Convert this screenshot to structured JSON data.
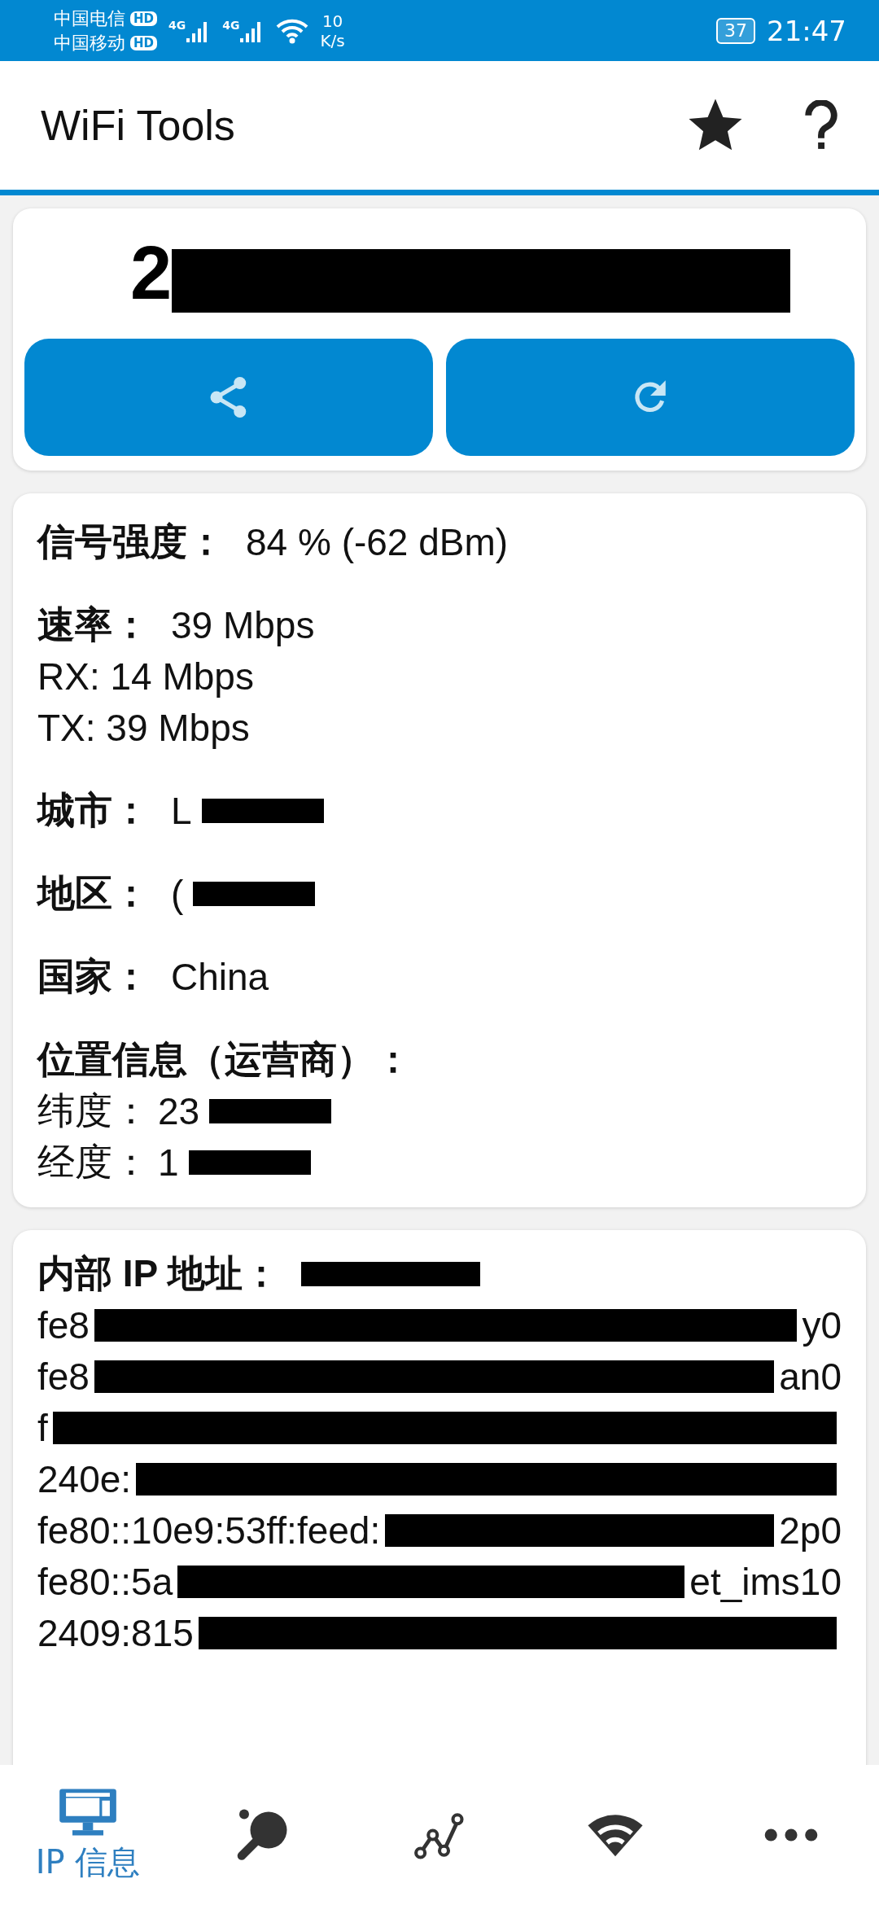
{
  "status_bar": {
    "carriers": [
      {
        "name": "中国电信",
        "badge": "HD",
        "network": "4G"
      },
      {
        "name": "中国移动",
        "badge": "HD",
        "network": "4G"
      }
    ],
    "speed_value": "10",
    "speed_unit": "K/s",
    "battery": "37",
    "time": "21:47"
  },
  "app_bar": {
    "title": "WiFi Tools"
  },
  "ip_card": {
    "address": [
      {
        "kind": "text",
        "text": "2"
      },
      {
        "kind": "redacted"
      }
    ]
  },
  "info_card": {
    "groups": [
      {
        "lines": [
          {
            "label": "信号强度：",
            "value": [
              {
                "kind": "text",
                "text": "84 % (-62 dBm)"
              }
            ]
          }
        ]
      },
      {
        "lines": [
          {
            "label": "速率：",
            "value": [
              {
                "kind": "text",
                "text": "39 Mbps"
              }
            ]
          },
          {
            "value": [
              {
                "kind": "text",
                "text": "RX: 14 Mbps"
              }
            ]
          },
          {
            "value": [
              {
                "kind": "text",
                "text": "TX: 39 Mbps"
              }
            ]
          }
        ]
      },
      {
        "lines": [
          {
            "label": "城市：",
            "value": [
              {
                "kind": "text",
                "text": "L"
              },
              {
                "kind": "redacted"
              }
            ]
          }
        ]
      },
      {
        "lines": [
          {
            "label": "地区：",
            "value": [
              {
                "kind": "text",
                "text": "("
              },
              {
                "kind": "redacted"
              }
            ]
          }
        ]
      },
      {
        "lines": [
          {
            "label": "国家：",
            "value": [
              {
                "kind": "text",
                "text": "China"
              }
            ]
          }
        ]
      },
      {
        "lines": [
          {
            "label": "位置信息（运营商）："
          },
          {
            "sublabel": "纬度：",
            "value": [
              {
                "kind": "text",
                "text": "23"
              },
              {
                "kind": "redacted"
              }
            ]
          },
          {
            "sublabel": "经度：",
            "value": [
              {
                "kind": "text",
                "text": "1"
              },
              {
                "kind": "redacted"
              }
            ]
          }
        ]
      }
    ]
  },
  "ip_list_card": {
    "label": "内部 IP 地址：",
    "header_value": [
      {
        "kind": "redacted"
      }
    ],
    "lines": [
      [
        {
          "kind": "text",
          "text": "fe8"
        },
        {
          "kind": "redacted"
        },
        {
          "kind": "text",
          "text": "y0"
        }
      ],
      [
        {
          "kind": "text",
          "text": "fe8"
        },
        {
          "kind": "redacted"
        },
        {
          "kind": "text",
          "text": "an0"
        }
      ],
      [
        {
          "kind": "text",
          "text": "f"
        },
        {
          "kind": "redacted"
        }
      ],
      [
        {
          "kind": "text",
          "text": "240e:"
        },
        {
          "kind": "redacted"
        }
      ],
      [
        {
          "kind": "text",
          "text": "fe80::10e9:53ff:feed:"
        },
        {
          "kind": "redacted"
        },
        {
          "kind": "text",
          "text": "2p0"
        }
      ],
      [
        {
          "kind": "text",
          "text": "fe80::5a"
        },
        {
          "kind": "redacted"
        },
        {
          "kind": "text",
          "text": "et_ims10"
        }
      ],
      [
        {
          "kind": "text",
          "text": "2409:815"
        },
        {
          "kind": "redacted"
        }
      ]
    ]
  },
  "bottom_nav": [
    {
      "kind": "monitor",
      "label": "IP 信息",
      "selected": true
    },
    {
      "kind": "paddle",
      "selected": false
    },
    {
      "kind": "graph",
      "selected": false
    },
    {
      "kind": "wifi",
      "selected": false
    },
    {
      "kind": "more",
      "selected": false
    }
  ]
}
